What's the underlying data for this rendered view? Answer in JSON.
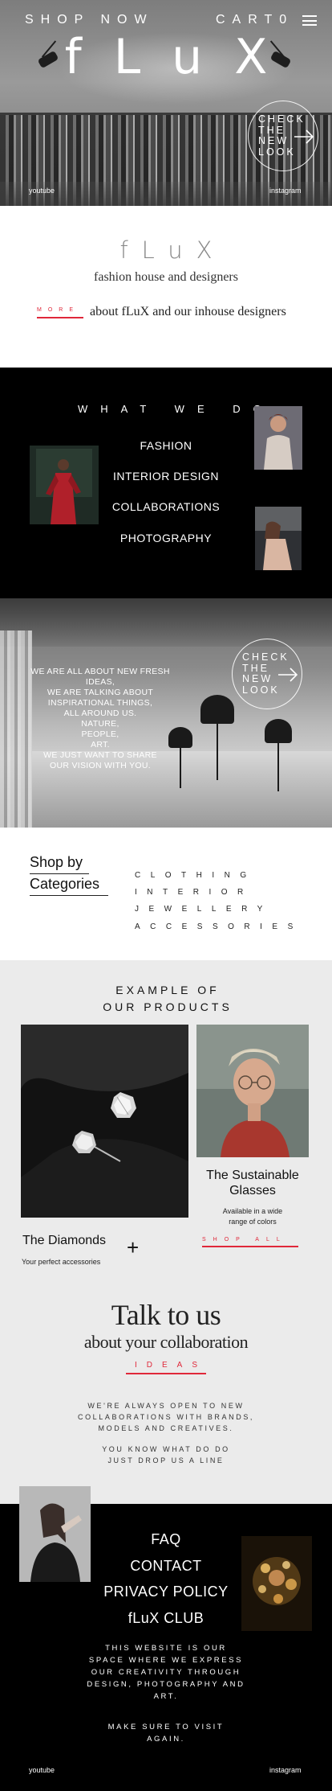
{
  "hero": {
    "shop_now": "SHOP NOW",
    "cart_label": "CART",
    "cart_count": "0",
    "brand": "fLuX",
    "cta_lines": [
      "CHECK",
      "THE",
      "NEW",
      "LOOK"
    ],
    "youtube": "youtube",
    "instagram": "instagram"
  },
  "intro": {
    "brand": "fLuX",
    "subtitle": "fashion house and designers",
    "more_label": "MORE",
    "more_text": "about fLuX and our inhouse designers"
  },
  "what_we_do": {
    "title": "WHAT WE DO",
    "items": [
      "FASHION",
      "INTERIOR DESIGN",
      "COLLABORATIONS",
      "PHOTOGRAPHY"
    ]
  },
  "studio": {
    "lines": [
      "WE ARE ALL ABOUT NEW FRESH IDEAS,",
      "WE ARE TALKING ABOUT",
      "INSPIRATIONAL THINGS,",
      "ALL AROUND US.",
      "NATURE,",
      "PEOPLE,",
      "ART.",
      "WE JUST WANT TO SHARE",
      "OUR VISION WITH YOU."
    ],
    "cta_lines": [
      "CHECK",
      "THE",
      "NEW",
      "LOOK"
    ]
  },
  "categories": {
    "heading_line1": "Shop by",
    "heading_line2": "Categories",
    "items": [
      "CLOTHING",
      "INTERIOR",
      "JEWELLERY",
      "ACCESSORIES"
    ]
  },
  "products": {
    "title_line1": "EXAMPLE OF",
    "title_line2": "OUR PRODUCTS",
    "diamonds_name": "The Diamonds",
    "diamonds_sub": "Your perfect accessories",
    "glasses_name_line1": "The Sustainable",
    "glasses_name_line2": "Glasses",
    "glasses_sub_line1": "Available in a wide",
    "glasses_sub_line2": "range of colors",
    "plus": "+",
    "shop_all": "SHOP ALL"
  },
  "talk": {
    "title": "Talk to us",
    "subtitle": "about your collaboration",
    "ideas": "IDEAS",
    "para1": [
      "WE'RE ALWAYS OPEN TO NEW",
      "COLLABORATIONS WITH BRANDS,",
      "MODELS AND CREATIVES."
    ],
    "para2": [
      "YOU KNOW WHAT DO DO",
      "JUST DROP US A LINE"
    ]
  },
  "footer": {
    "links": [
      "FAQ",
      "CONTACT",
      "PRIVACY POLICY",
      "fLuX CLUB"
    ],
    "para1": [
      "THIS WEBSITE IS OUR",
      "SPACE WHERE WE EXPRESS",
      "OUR CREATIVITY THROUGH",
      "DESIGN, PHOTOGRAPHY AND",
      "ART."
    ],
    "para2": [
      "MAKE SURE TO VISIT",
      "AGAIN."
    ],
    "youtube": "youtube",
    "instagram": "instagram"
  },
  "colors": {
    "accent": "#e0283a",
    "dark": "#000000",
    "light_section": "#ebebeb"
  },
  "icons": [
    "menu-icon",
    "arrow-right-icon"
  ]
}
